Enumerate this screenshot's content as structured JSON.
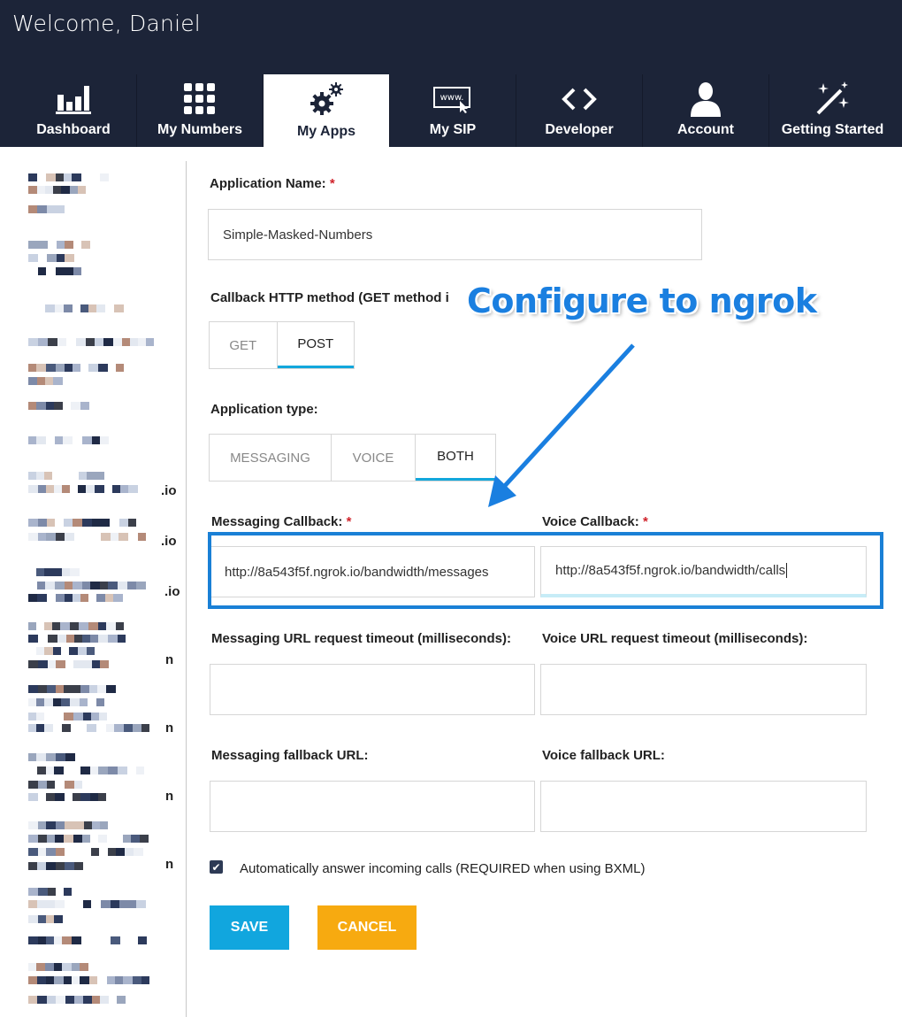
{
  "header": {
    "welcome": "Welcome, Daniel",
    "tabs": [
      {
        "label": "Dashboard",
        "icon": "bar-chart-icon",
        "active": false
      },
      {
        "label": "My Numbers",
        "icon": "keypad-grid-icon",
        "active": false
      },
      {
        "label": "My Apps",
        "icon": "gears-icon",
        "active": true
      },
      {
        "label": "My SIP",
        "icon": "www-browser-icon",
        "active": false
      },
      {
        "label": "Developer",
        "icon": "code-brackets-icon",
        "active": false
      },
      {
        "label": "Account",
        "icon": "user-icon",
        "active": false
      },
      {
        "label": "Getting Started",
        "icon": "magic-wand-icon",
        "active": false
      }
    ]
  },
  "sidebar": {
    "visible_suffixes": [
      ".io",
      ".io",
      ".io",
      "n",
      "n",
      "n",
      "n"
    ]
  },
  "form": {
    "app_name_label": "Application Name:",
    "app_name_value": "Simple-Masked-Numbers",
    "required_mark": "*",
    "callback_method_label": "Callback HTTP method (GET method i",
    "callback_method_options": [
      "GET",
      "POST"
    ],
    "callback_method_selected": "POST",
    "app_type_label": "Application type:",
    "app_type_options": [
      "MESSAGING",
      "VOICE",
      "BOTH"
    ],
    "app_type_selected": "BOTH",
    "messaging_callback_label": "Messaging Callback:",
    "messaging_callback_value": "http://8a543f5f.ngrok.io/bandwidth/messages",
    "voice_callback_label": "Voice Callback:",
    "voice_callback_value": "http://8a543f5f.ngrok.io/bandwidth/calls",
    "messaging_timeout_label": "Messaging URL request timeout (milliseconds):",
    "messaging_timeout_value": "",
    "voice_timeout_label": "Voice URL request timeout (milliseconds):",
    "voice_timeout_value": "",
    "messaging_fallback_label": "Messaging fallback URL:",
    "messaging_fallback_value": "",
    "voice_fallback_label": "Voice fallback URL:",
    "voice_fallback_value": "",
    "auto_answer_label": "Automatically answer incoming calls (REQUIRED when using BXML)",
    "auto_answer_checked": true,
    "save_label": "SAVE",
    "cancel_label": "CANCEL"
  },
  "annotation": {
    "callout_text": "Configure to ngrok",
    "color": "#1a7fe0"
  },
  "colors": {
    "header_bg": "#1c2438",
    "accent": "#12a7dc",
    "save": "#11a6de",
    "cancel": "#f7aa10"
  }
}
